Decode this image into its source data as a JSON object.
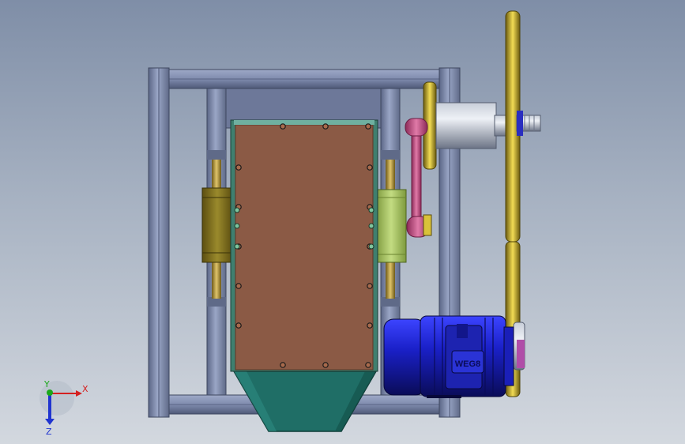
{
  "viewport": {
    "background_top": "#7f8ea7",
    "background_bottom": "#d3d8df"
  },
  "colors": {
    "frame_steel": "#8491b3",
    "frame_edge": "#4a5470",
    "plate_brown": "#8b5a45",
    "plate_border_green": "#3f7f6f",
    "hopper_teal": "#1f6e66",
    "bearing_olive": "#8a7a22",
    "bearing_green": "#a8c56a",
    "brass_rod": "#b89a3a",
    "link_pink": "#c0487e",
    "motor_blue": "#1a1fb8",
    "pulley_yellow": "#d9c23a",
    "shaft_grey": "#aeb5c4"
  },
  "motor": {
    "nameplate_text": "WEG8",
    "icon": "electric-motor-icon"
  },
  "axis_triad": {
    "x_label": "X",
    "y_label": "Y",
    "z_label": "Z",
    "x_color": "#d42020",
    "y_color": "#1aa81a",
    "z_color": "#2034d0"
  }
}
